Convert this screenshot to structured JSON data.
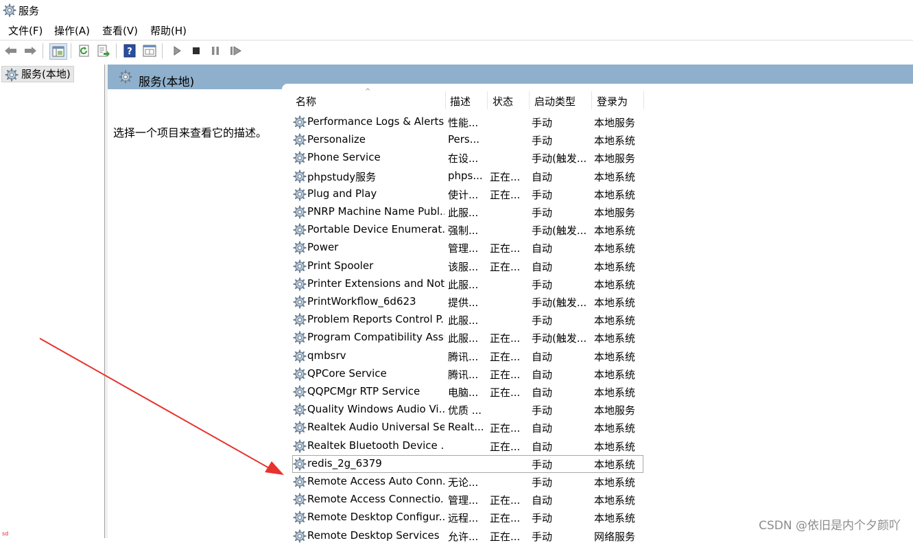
{
  "window": {
    "title": "服务"
  },
  "menu": [
    "文件(F)",
    "操作(A)",
    "查看(V)",
    "帮助(H)"
  ],
  "toolbar": {
    "buttons": [
      "back-icon",
      "forward-icon",
      "console-tree-icon",
      "refresh-icon",
      "export-list-icon",
      "help-icon",
      "properties-icon",
      "start-service-icon",
      "stop-service-icon",
      "pause-service-icon",
      "restart-service-icon"
    ]
  },
  "tree": {
    "root_label": "服务(本地)"
  },
  "main": {
    "header": "服务(本地)",
    "description_hint": "选择一个项目来查看它的描述。",
    "columns": [
      "名称",
      "描述",
      "状态",
      "启动类型",
      "登录为"
    ],
    "rows": [
      {
        "name": "Performance Logs & Alerts",
        "desc": "性能...",
        "status": "",
        "startup": "手动",
        "logon": "本地服务"
      },
      {
        "name": "Personalize",
        "desc": "Pers...",
        "status": "",
        "startup": "手动",
        "logon": "本地系统"
      },
      {
        "name": "Phone Service",
        "desc": "在设...",
        "status": "",
        "startup": "手动(触发...",
        "logon": "本地服务"
      },
      {
        "name": "phpstudy服务",
        "desc": "phps...",
        "status": "正在...",
        "startup": "自动",
        "logon": "本地系统"
      },
      {
        "name": "Plug and Play",
        "desc": "使计...",
        "status": "正在...",
        "startup": "手动",
        "logon": "本地系统"
      },
      {
        "name": "PNRP Machine Name Publ...",
        "desc": "此服...",
        "status": "",
        "startup": "手动",
        "logon": "本地服务"
      },
      {
        "name": "Portable Device Enumerat...",
        "desc": "强制...",
        "status": "",
        "startup": "手动(触发...",
        "logon": "本地系统"
      },
      {
        "name": "Power",
        "desc": "管理...",
        "status": "正在...",
        "startup": "自动",
        "logon": "本地系统"
      },
      {
        "name": "Print Spooler",
        "desc": "该服...",
        "status": "正在...",
        "startup": "自动",
        "logon": "本地系统"
      },
      {
        "name": "Printer Extensions and Noti...",
        "desc": "此服...",
        "status": "",
        "startup": "手动",
        "logon": "本地系统"
      },
      {
        "name": "PrintWorkflow_6d623",
        "desc": "提供...",
        "status": "",
        "startup": "手动(触发...",
        "logon": "本地系统"
      },
      {
        "name": "Problem Reports Control P...",
        "desc": "此服...",
        "status": "",
        "startup": "手动",
        "logon": "本地系统"
      },
      {
        "name": "Program Compatibility Assi...",
        "desc": "此服...",
        "status": "正在...",
        "startup": "手动(触发...",
        "logon": "本地系统"
      },
      {
        "name": "qmbsrv",
        "desc": "腾讯...",
        "status": "正在...",
        "startup": "自动",
        "logon": "本地系统"
      },
      {
        "name": "QPCore Service",
        "desc": "腾讯...",
        "status": "正在...",
        "startup": "自动",
        "logon": "本地系统"
      },
      {
        "name": "QQPCMgr RTP Service",
        "desc": "电脑...",
        "status": "正在...",
        "startup": "自动",
        "logon": "本地系统"
      },
      {
        "name": "Quality Windows Audio Vi...",
        "desc": "优质 ...",
        "status": "",
        "startup": "手动",
        "logon": "本地服务"
      },
      {
        "name": "Realtek Audio Universal Se...",
        "desc": "Realt...",
        "status": "正在...",
        "startup": "自动",
        "logon": "本地系统"
      },
      {
        "name": "Realtek Bluetooth Device ...",
        "desc": "",
        "status": "正在...",
        "startup": "自动",
        "logon": "本地系统"
      },
      {
        "name": "redis_2g_6379",
        "desc": "",
        "status": "",
        "startup": "手动",
        "logon": "本地系统",
        "selected": true
      },
      {
        "name": "Remote Access Auto Conn...",
        "desc": "无论...",
        "status": "",
        "startup": "手动",
        "logon": "本地系统"
      },
      {
        "name": "Remote Access Connectio...",
        "desc": "管理...",
        "status": "正在...",
        "startup": "自动",
        "logon": "本地系统"
      },
      {
        "name": "Remote Desktop Configur...",
        "desc": "远程...",
        "status": "正在...",
        "startup": "手动",
        "logon": "本地系统"
      },
      {
        "name": "Remote Desktop Services",
        "desc": "允许...",
        "status": "正在...",
        "startup": "手动",
        "logon": "网络服务"
      }
    ]
  },
  "watermark": "CSDN @依旧是内个夕颜吖",
  "corner_mark": "sd",
  "colors": {
    "header_band": "#8fb0cc",
    "arrow": "#e8322c"
  }
}
